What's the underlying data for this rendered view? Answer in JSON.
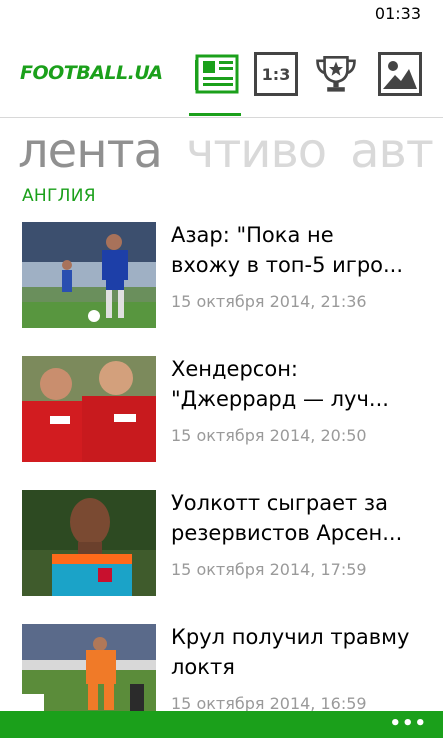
{
  "status": {
    "time": "01:33"
  },
  "header": {
    "logo": "FOOTBALL.UA",
    "tabs": [
      {
        "icon": "news-icon",
        "active": true
      },
      {
        "icon": "score-icon",
        "label": "1:3"
      },
      {
        "icon": "trophy-icon"
      },
      {
        "icon": "photo-icon"
      }
    ],
    "accent": "#1ba01b"
  },
  "pivot": {
    "items": [
      "лента",
      "чтиво",
      "авт"
    ]
  },
  "section": "АНГЛИЯ",
  "articles": [
    {
      "title": "Азар: \"Пока не\nвхожу в топ-5 игро...",
      "date": "15 октября 2014, 21:36"
    },
    {
      "title": "Хендерсон:\n\"Джеррард — луч...",
      "date": "15 октября 2014, 20:50"
    },
    {
      "title": "Уолкотт сыграет за\nрезервистов Арсен...",
      "date": "15 октября 2014, 17:59"
    },
    {
      "title": "Крул получил травму\nлоктя",
      "date": "15 октября 2014, 16:59"
    }
  ],
  "appbar": {
    "more_label": "•••"
  }
}
